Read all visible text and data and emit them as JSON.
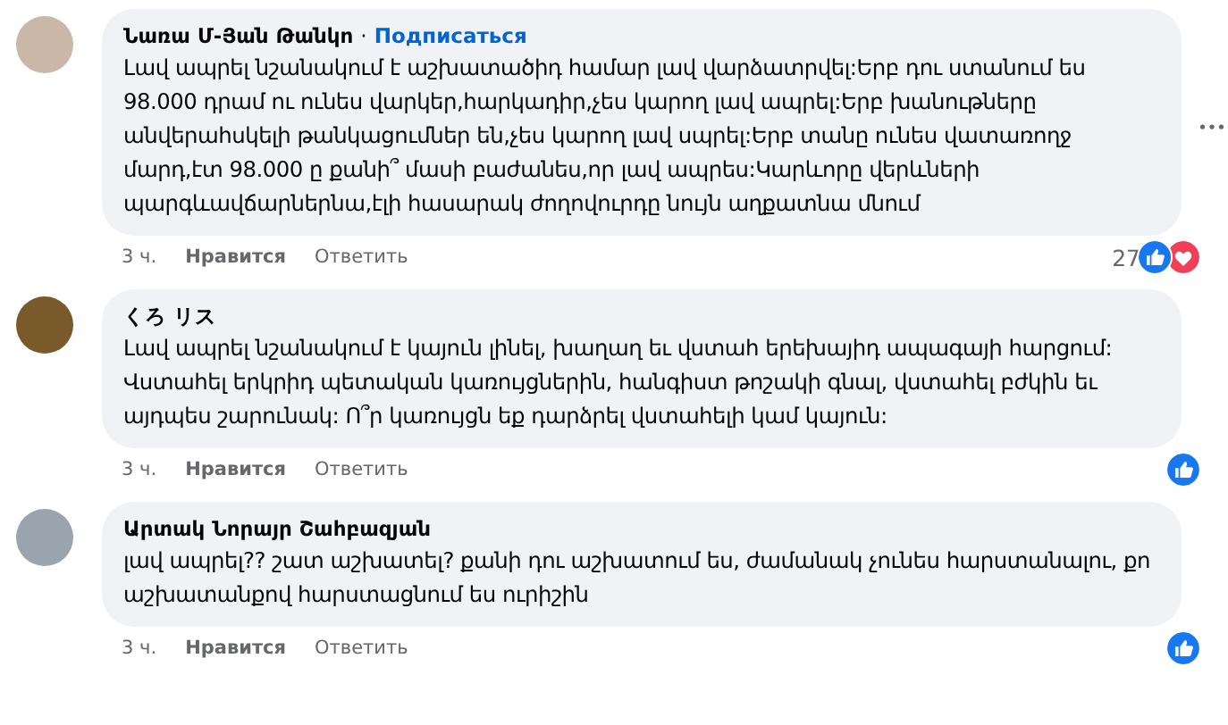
{
  "comments": [
    {
      "author": "Նառա Մ-Յան Թանկո",
      "separator": "·",
      "subscribe": "Подписаться",
      "text": "Լավ ապրել նշանակում է աշխատածիդ համար լավ վարձատրվել:Երբ դու ստանում ես 98.000 դրամ ու ունես վարկեր,հարկադիր,չես կարող լավ ապրել:Երբ խանութները անվերահսկելի թանկացումներ են,չես կարող լավ սպրել:Երբ տանը ունես վատառողջ մարդ,էտ 98.000 ը քանի՞ մասի բաժանես,որ լավ ապրես:Կարևորը վերևների պարգևավճարներնա,էլի հասարակ ժողովուրդը նույն աղքատնա մնում",
      "time": "3 ч.",
      "like": "Нравится",
      "reply": "Ответить",
      "reaction_count": "27",
      "reactions": [
        {
          "kind": "like"
        },
        {
          "kind": "love"
        }
      ],
      "more": true
    },
    {
      "author": "くろ リス",
      "text": "Լավ ապրել նշանակում է կայուն լինել, խաղաղ եւ վստահ երեխայիդ ապագայի հարցում: Վստահել երկրիդ պետական կառույցներին, հանգիստ թոշակի գնալ, վստահել բժկին եւ այդպես շարունակ: Ո՞ր կառույցն եք դարձրել վստահելի կամ կայուն:",
      "time": "3 ч.",
      "like": "Нравится",
      "reply": "Ответить",
      "reactions": [
        {
          "kind": "like"
        }
      ],
      "more": false
    },
    {
      "author": "Արտակ Նորայր Շահբազյան",
      "text": "լավ ապրել?? շատ աշխատել? քանի դու աշխատում ես, ժամանակ չունես հարստանալու, քո աշխատանքով հարստացնում ես ուրիշին",
      "time": "3 ч.",
      "like": "Нравится",
      "reply": "Ответить",
      "reactions": [
        {
          "kind": "like"
        }
      ],
      "more": false
    }
  ]
}
